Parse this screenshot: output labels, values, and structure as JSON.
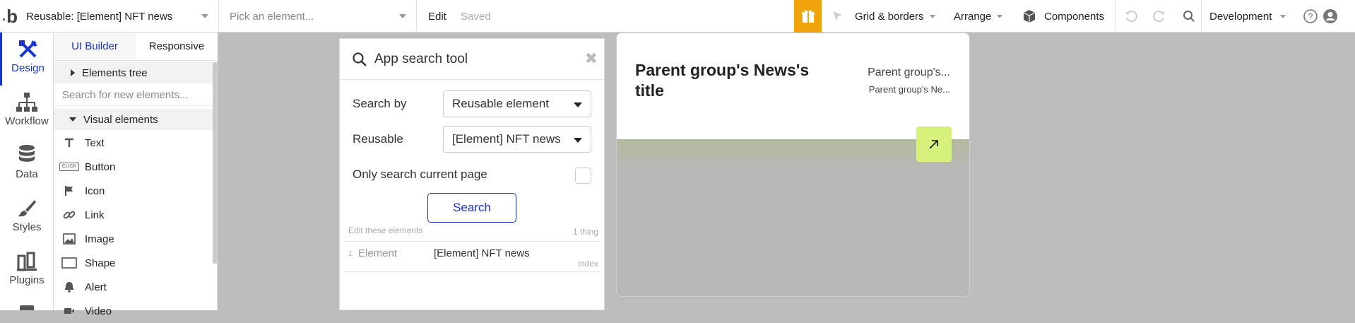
{
  "topbar": {
    "logo_text": "b",
    "page_selector": "Reusable: [Element] NFT news",
    "element_selector_placeholder": "Pick an element...",
    "edit_label": "Edit",
    "saved_label": "Saved",
    "grid_label": "Grid & borders",
    "arrange_label": "Arrange",
    "components_label": "Components",
    "environment_label": "Development",
    "gift_color": "#f0a30a"
  },
  "rail": {
    "items": [
      {
        "label": "Design",
        "icon": "design-icon"
      },
      {
        "label": "Workflow",
        "icon": "workflow-icon"
      },
      {
        "label": "Data",
        "icon": "database-icon"
      },
      {
        "label": "Styles",
        "icon": "brush-icon"
      },
      {
        "label": "Plugins",
        "icon": "plugins-icon"
      }
    ],
    "accent_color": "#1a33cc"
  },
  "panel": {
    "tabs": [
      {
        "label": "UI Builder"
      },
      {
        "label": "Responsive"
      }
    ],
    "elements_tree_label": "Elements tree",
    "search_placeholder": "Search for new elements...",
    "visual_elements_label": "Visual elements",
    "elements": [
      {
        "label": "Text",
        "icon": "text-icon"
      },
      {
        "label": "Button",
        "icon": "button-icon"
      },
      {
        "label": "Icon",
        "icon": "flag-icon"
      },
      {
        "label": "Link",
        "icon": "link-icon"
      },
      {
        "label": "Image",
        "icon": "image-icon"
      },
      {
        "label": "Shape",
        "icon": "shape-icon"
      },
      {
        "label": "Alert",
        "icon": "bell-icon"
      },
      {
        "label": "Video",
        "icon": "video-icon"
      }
    ],
    "button_icon_text": "CLICK"
  },
  "search_tool": {
    "title": "App search tool",
    "search_by_label": "Search by",
    "search_by_value": "Reusable element",
    "reusable_label": "Reusable",
    "reusable_value": "[Element] NFT news",
    "only_current_label": "Only search current page",
    "search_button": "Search",
    "results_header": "Edit these elements",
    "results_count": "1 thing",
    "results": [
      {
        "index": "1",
        "type": "Element",
        "name": "[Element] NFT news",
        "tag": "index"
      }
    ]
  },
  "canvas": {
    "card_title": "Parent group's News's title",
    "card_meta_1": "Parent group's...",
    "card_meta_2": "Parent group's Ne...",
    "accent_color": "#d6f27a"
  }
}
